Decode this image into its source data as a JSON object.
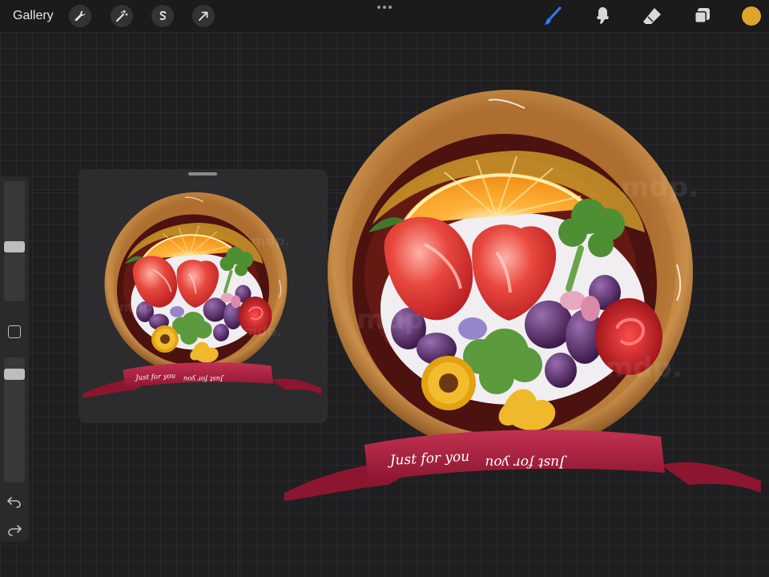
{
  "topbar": {
    "gallery_label": "Gallery",
    "left_tools": [
      "wrench-icon",
      "magic-wand-icon",
      "selection-s-icon",
      "arrow-transform-icon"
    ],
    "right_tools": [
      "brush-icon",
      "smudge-icon",
      "eraser-icon",
      "layers-icon"
    ],
    "brush_active_color": "#2f7df6",
    "current_color": "#dca42c"
  },
  "sidebar": {
    "size_slider_level": 0.45,
    "opacity_slider_level": 0.1,
    "undo_icon": "undo-icon",
    "redo_icon": "redo-icon"
  },
  "artwork": {
    "ribbon_text_left": "Just for you",
    "ribbon_text_right": "Just for you",
    "watermark": "mdp."
  }
}
